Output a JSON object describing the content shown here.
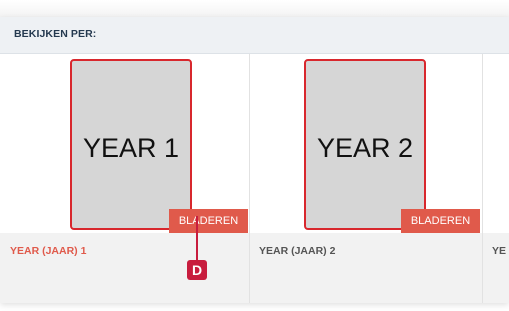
{
  "header": {
    "title": "BEKIJKEN PER:"
  },
  "items": [
    {
      "cover_text": "YEAR 1",
      "browse_label": "BLADEREN",
      "caption": "YEAR (JAAR) 1",
      "active": true
    },
    {
      "cover_text": "YEAR 2",
      "browse_label": "BLADEREN",
      "caption": "YEAR (JAAR) 2",
      "active": false
    },
    {
      "caption": "YE"
    }
  ],
  "annotation": {
    "marker_label": "D"
  },
  "colors": {
    "accent": "#e05a4b",
    "cover_border": "#d8272d",
    "marker": "#c81d3e"
  }
}
